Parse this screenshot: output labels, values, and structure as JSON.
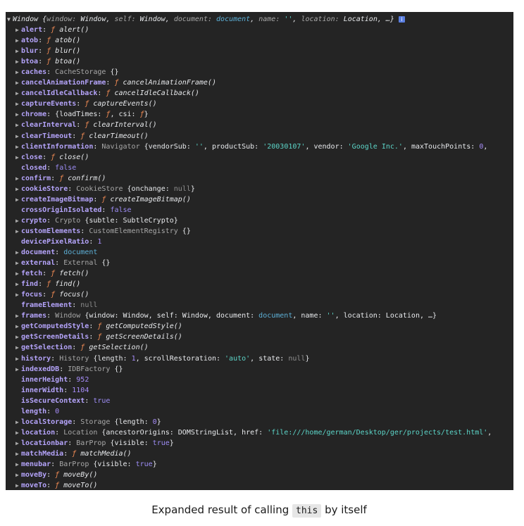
{
  "window_header": {
    "label": "Window",
    "open_brace": " {",
    "summary": [
      {
        "k": "window",
        "v": "Window",
        "t": "plain"
      },
      {
        "k": "self",
        "v": "Window",
        "t": "plain"
      },
      {
        "k": "document",
        "v": "document",
        "t": "obj"
      },
      {
        "k": "name",
        "v": "''",
        "t": "str"
      },
      {
        "k": "location",
        "v": "Location",
        "t": "plain"
      }
    ],
    "ellipsis": "…}"
  },
  "properties": [
    {
      "key": "alert",
      "expandable": true,
      "parts": [
        {
          "t": "f",
          "v": "ƒ "
        },
        {
          "t": "fn",
          "v": "alert()"
        }
      ]
    },
    {
      "key": "atob",
      "expandable": true,
      "parts": [
        {
          "t": "f",
          "v": "ƒ "
        },
        {
          "t": "fn",
          "v": "atob()"
        }
      ]
    },
    {
      "key": "blur",
      "expandable": true,
      "parts": [
        {
          "t": "f",
          "v": "ƒ "
        },
        {
          "t": "fn",
          "v": "blur()"
        }
      ]
    },
    {
      "key": "btoa",
      "expandable": true,
      "parts": [
        {
          "t": "f",
          "v": "ƒ "
        },
        {
          "t": "fn",
          "v": "btoa()"
        }
      ]
    },
    {
      "key": "caches",
      "expandable": true,
      "parts": [
        {
          "t": "cls",
          "v": "CacheStorage "
        },
        {
          "t": "plain",
          "v": "{}"
        }
      ]
    },
    {
      "key": "cancelAnimationFrame",
      "expandable": true,
      "parts": [
        {
          "t": "f",
          "v": "ƒ "
        },
        {
          "t": "fn",
          "v": "cancelAnimationFrame()"
        }
      ]
    },
    {
      "key": "cancelIdleCallback",
      "expandable": true,
      "parts": [
        {
          "t": "f",
          "v": "ƒ "
        },
        {
          "t": "fn",
          "v": "cancelIdleCallback()"
        }
      ]
    },
    {
      "key": "captureEvents",
      "expandable": true,
      "parts": [
        {
          "t": "f",
          "v": "ƒ "
        },
        {
          "t": "fn",
          "v": "captureEvents()"
        }
      ]
    },
    {
      "key": "chrome",
      "expandable": true,
      "parts": [
        {
          "t": "plain",
          "v": "{loadTimes: "
        },
        {
          "t": "f",
          "v": "ƒ"
        },
        {
          "t": "plain",
          "v": ", csi: "
        },
        {
          "t": "f",
          "v": "ƒ"
        },
        {
          "t": "plain",
          "v": "}"
        }
      ]
    },
    {
      "key": "clearInterval",
      "expandable": true,
      "parts": [
        {
          "t": "f",
          "v": "ƒ "
        },
        {
          "t": "fn",
          "v": "clearInterval()"
        }
      ]
    },
    {
      "key": "clearTimeout",
      "expandable": true,
      "parts": [
        {
          "t": "f",
          "v": "ƒ "
        },
        {
          "t": "fn",
          "v": "clearTimeout()"
        }
      ]
    },
    {
      "key": "clientInformation",
      "expandable": true,
      "parts": [
        {
          "t": "cls",
          "v": "Navigator "
        },
        {
          "t": "plain",
          "v": "{vendorSub: "
        },
        {
          "t": "str",
          "v": "''"
        },
        {
          "t": "plain",
          "v": ", productSub: "
        },
        {
          "t": "str",
          "v": "'20030107'"
        },
        {
          "t": "plain",
          "v": ", vendor: "
        },
        {
          "t": "str",
          "v": "'Google Inc.'"
        },
        {
          "t": "plain",
          "v": ", maxTouchPoints: "
        },
        {
          "t": "num",
          "v": "0"
        },
        {
          "t": "plain",
          "v": ","
        }
      ]
    },
    {
      "key": "close",
      "expandable": true,
      "parts": [
        {
          "t": "f",
          "v": "ƒ "
        },
        {
          "t": "fn",
          "v": "close()"
        }
      ]
    },
    {
      "key": "closed",
      "expandable": false,
      "parts": [
        {
          "t": "kw",
          "v": "false"
        }
      ]
    },
    {
      "key": "confirm",
      "expandable": true,
      "parts": [
        {
          "t": "f",
          "v": "ƒ "
        },
        {
          "t": "fn",
          "v": "confirm()"
        }
      ]
    },
    {
      "key": "cookieStore",
      "expandable": true,
      "parts": [
        {
          "t": "cls",
          "v": "CookieStore "
        },
        {
          "t": "plain",
          "v": "{onchange: "
        },
        {
          "t": "nul",
          "v": "null"
        },
        {
          "t": "plain",
          "v": "}"
        }
      ]
    },
    {
      "key": "createImageBitmap",
      "expandable": true,
      "parts": [
        {
          "t": "f",
          "v": "ƒ "
        },
        {
          "t": "fn",
          "v": "createImageBitmap()"
        }
      ]
    },
    {
      "key": "crossOriginIsolated",
      "expandable": false,
      "parts": [
        {
          "t": "kw",
          "v": "false"
        }
      ]
    },
    {
      "key": "crypto",
      "expandable": true,
      "parts": [
        {
          "t": "cls",
          "v": "Crypto "
        },
        {
          "t": "plain",
          "v": "{subtle: SubtleCrypto}"
        }
      ]
    },
    {
      "key": "customElements",
      "expandable": true,
      "parts": [
        {
          "t": "cls",
          "v": "CustomElementRegistry "
        },
        {
          "t": "plain",
          "v": "{}"
        }
      ]
    },
    {
      "key": "devicePixelRatio",
      "expandable": false,
      "parts": [
        {
          "t": "num",
          "v": "1"
        }
      ]
    },
    {
      "key": "document",
      "expandable": true,
      "parts": [
        {
          "t": "obj",
          "v": "document"
        }
      ]
    },
    {
      "key": "external",
      "expandable": true,
      "parts": [
        {
          "t": "cls",
          "v": "External "
        },
        {
          "t": "plain",
          "v": "{}"
        }
      ]
    },
    {
      "key": "fetch",
      "expandable": true,
      "parts": [
        {
          "t": "f",
          "v": "ƒ "
        },
        {
          "t": "fn",
          "v": "fetch()"
        }
      ]
    },
    {
      "key": "find",
      "expandable": true,
      "parts": [
        {
          "t": "f",
          "v": "ƒ "
        },
        {
          "t": "fn",
          "v": "find()"
        }
      ]
    },
    {
      "key": "focus",
      "expandable": true,
      "parts": [
        {
          "t": "f",
          "v": "ƒ "
        },
        {
          "t": "fn",
          "v": "focus()"
        }
      ]
    },
    {
      "key": "frameElement",
      "expandable": false,
      "parts": [
        {
          "t": "nul",
          "v": "null"
        }
      ]
    },
    {
      "key": "frames",
      "expandable": true,
      "parts": [
        {
          "t": "cls",
          "v": "Window "
        },
        {
          "t": "plain",
          "v": "{window: Window, self: Window, document: "
        },
        {
          "t": "obj",
          "v": "document"
        },
        {
          "t": "plain",
          "v": ", name: "
        },
        {
          "t": "str",
          "v": "''"
        },
        {
          "t": "plain",
          "v": ", location: Location, …}"
        }
      ]
    },
    {
      "key": "getComputedStyle",
      "expandable": true,
      "parts": [
        {
          "t": "f",
          "v": "ƒ "
        },
        {
          "t": "fn",
          "v": "getComputedStyle()"
        }
      ]
    },
    {
      "key": "getScreenDetails",
      "expandable": true,
      "parts": [
        {
          "t": "f",
          "v": "ƒ "
        },
        {
          "t": "fn",
          "v": "getScreenDetails()"
        }
      ]
    },
    {
      "key": "getSelection",
      "expandable": true,
      "parts": [
        {
          "t": "f",
          "v": "ƒ "
        },
        {
          "t": "fn",
          "v": "getSelection()"
        }
      ]
    },
    {
      "key": "history",
      "expandable": true,
      "parts": [
        {
          "t": "cls",
          "v": "History "
        },
        {
          "t": "plain",
          "v": "{length: "
        },
        {
          "t": "num",
          "v": "1"
        },
        {
          "t": "plain",
          "v": ", scrollRestoration: "
        },
        {
          "t": "str",
          "v": "'auto'"
        },
        {
          "t": "plain",
          "v": ", state: "
        },
        {
          "t": "nul",
          "v": "null"
        },
        {
          "t": "plain",
          "v": "}"
        }
      ]
    },
    {
      "key": "indexedDB",
      "expandable": true,
      "parts": [
        {
          "t": "cls",
          "v": "IDBFactory "
        },
        {
          "t": "plain",
          "v": "{}"
        }
      ]
    },
    {
      "key": "innerHeight",
      "expandable": false,
      "parts": [
        {
          "t": "num",
          "v": "952"
        }
      ]
    },
    {
      "key": "innerWidth",
      "expandable": false,
      "parts": [
        {
          "t": "num",
          "v": "1104"
        }
      ]
    },
    {
      "key": "isSecureContext",
      "expandable": false,
      "parts": [
        {
          "t": "kw",
          "v": "true"
        }
      ]
    },
    {
      "key": "length",
      "expandable": false,
      "parts": [
        {
          "t": "num",
          "v": "0"
        }
      ]
    },
    {
      "key": "localStorage",
      "expandable": true,
      "parts": [
        {
          "t": "cls",
          "v": "Storage "
        },
        {
          "t": "plain",
          "v": "{length: "
        },
        {
          "t": "num",
          "v": "0"
        },
        {
          "t": "plain",
          "v": "}"
        }
      ]
    },
    {
      "key": "location",
      "expandable": true,
      "parts": [
        {
          "t": "cls",
          "v": "Location "
        },
        {
          "t": "plain",
          "v": "{ancestorOrigins: DOMStringList, href: "
        },
        {
          "t": "str",
          "v": "'file:///home/german/Desktop/ger/projects/test.html'"
        },
        {
          "t": "plain",
          "v": ","
        }
      ]
    },
    {
      "key": "locationbar",
      "expandable": true,
      "parts": [
        {
          "t": "cls",
          "v": "BarProp "
        },
        {
          "t": "plain",
          "v": "{visible: "
        },
        {
          "t": "kw",
          "v": "true"
        },
        {
          "t": "plain",
          "v": "}"
        }
      ]
    },
    {
      "key": "matchMedia",
      "expandable": true,
      "parts": [
        {
          "t": "f",
          "v": "ƒ "
        },
        {
          "t": "fn",
          "v": "matchMedia()"
        }
      ]
    },
    {
      "key": "menubar",
      "expandable": true,
      "parts": [
        {
          "t": "cls",
          "v": "BarProp "
        },
        {
          "t": "plain",
          "v": "{visible: "
        },
        {
          "t": "kw",
          "v": "true"
        },
        {
          "t": "plain",
          "v": "}"
        }
      ]
    },
    {
      "key": "moveBy",
      "expandable": true,
      "parts": [
        {
          "t": "f",
          "v": "ƒ "
        },
        {
          "t": "fn",
          "v": "moveBy()"
        }
      ]
    },
    {
      "key": "moveTo",
      "expandable": true,
      "parts": [
        {
          "t": "f",
          "v": "ƒ "
        },
        {
          "t": "fn",
          "v": "moveTo()"
        }
      ]
    }
  ],
  "caption": {
    "before": "Expanded result of calling ",
    "code": "this",
    "after": " by itself"
  },
  "colors": {
    "console_bg": "#242424",
    "key": "#b5a4fb",
    "function_marker": "#f28b54",
    "string": "#5cd5c8",
    "number": "#a88efb",
    "object_link": "#5db0d7",
    "class_name": "#a8a8a8"
  },
  "icons": {
    "expand_arrow": "triangle-right",
    "collapse_arrow": "triangle-down",
    "info": "info-icon"
  }
}
